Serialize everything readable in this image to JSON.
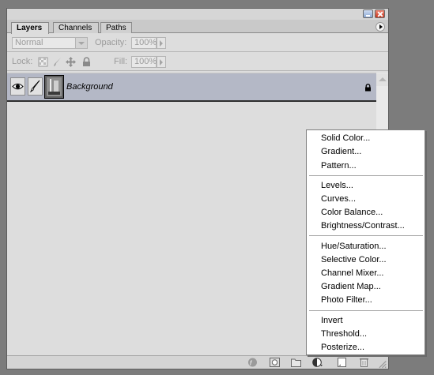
{
  "panel": {
    "tabs": [
      {
        "label": "Layers",
        "active": true
      },
      {
        "label": "Channels",
        "active": false
      },
      {
        "label": "Paths",
        "active": false
      }
    ],
    "blend_mode": "Normal",
    "opacity_label": "Opacity:",
    "opacity_value": "100%",
    "lock_label": "Lock:",
    "fill_label": "Fill:",
    "fill_value": "100%"
  },
  "layers": [
    {
      "name": "Background",
      "visible": true,
      "locked": true
    }
  ],
  "menu": {
    "groups": [
      [
        "Solid Color...",
        "Gradient...",
        "Pattern..."
      ],
      [
        "Levels...",
        "Curves...",
        "Color Balance...",
        "Brightness/Contrast..."
      ],
      [
        "Hue/Saturation...",
        "Selective Color...",
        "Channel Mixer...",
        "Gradient Map...",
        "Photo Filter..."
      ],
      [
        "Invert",
        "Threshold...",
        "Posterize..."
      ]
    ]
  },
  "icons": {
    "bottom_bar": [
      "link-icon",
      "fx-icon",
      "mask-icon",
      "new-group-icon",
      "adjustment-layer-icon",
      "new-layer-icon",
      "trash-icon"
    ]
  }
}
